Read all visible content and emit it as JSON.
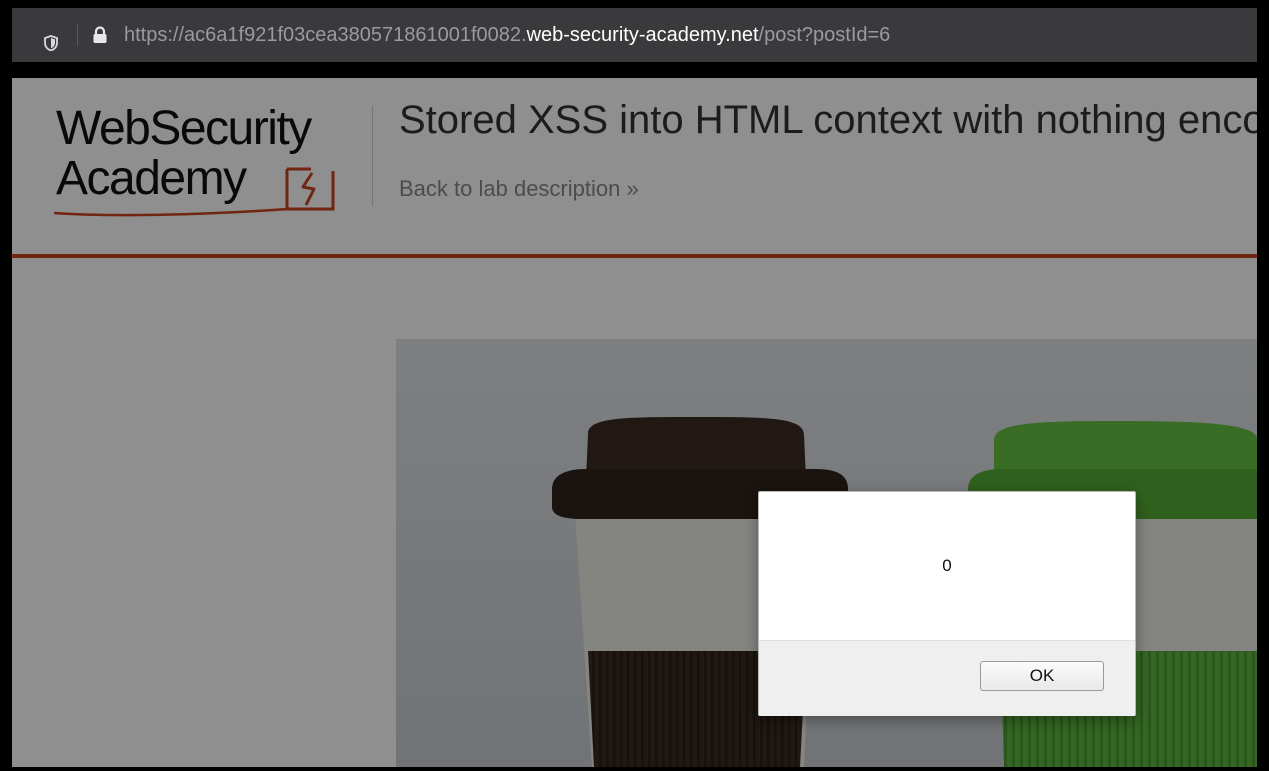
{
  "browser": {
    "url_prefix": "https://ac6a1f921f03cea380571861001f0082.",
    "url_host": "web-security-academy.net",
    "url_path": "/post?postId=6"
  },
  "header": {
    "logo_line1": "WebSecurity",
    "logo_line2": "Academy",
    "title": "Stored XSS into HTML context with nothing encoded",
    "back_link": "Back to lab description",
    "back_link_chevron": "»"
  },
  "dialog": {
    "message": "0",
    "ok_label": "OK"
  },
  "colors": {
    "accent": "#c8441e",
    "cup_brown": "#3b2b22",
    "cup_green": "#5fb83e"
  }
}
